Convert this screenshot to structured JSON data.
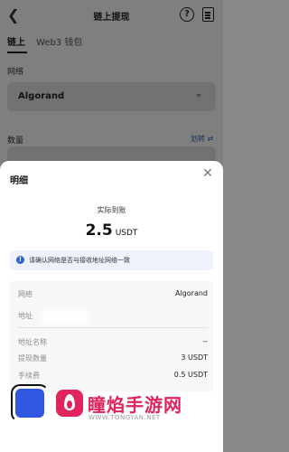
{
  "header": {
    "title": "链上提现",
    "help_icon": "question-circle-icon",
    "records_icon": "document-icon"
  },
  "tabs": [
    {
      "label": "链上"
    },
    {
      "label": "Web3 钱包"
    }
  ],
  "form": {
    "network_label": "网络",
    "network_value": "Algorand",
    "amount_label": "数量",
    "transfer_label": "划转 ⇄"
  },
  "sheet": {
    "title": "明细",
    "received_label": "实际到账",
    "received_amount": "2.5",
    "received_unit": "USDT",
    "notice": "请确认网络是否与接收地址网络一致",
    "rows": [
      {
        "label": "网络",
        "value": "Algorand"
      },
      {
        "label": "地址",
        "value": ""
      },
      {
        "label": "地址名称",
        "value": "--"
      },
      {
        "label": "提现数量",
        "value": "3 USDT"
      },
      {
        "label": "手续费",
        "value": "0.5 USDT"
      }
    ]
  },
  "watermark": {
    "name": "瞳焰手游网",
    "url": "WWW.TONGYAN.NET"
  }
}
